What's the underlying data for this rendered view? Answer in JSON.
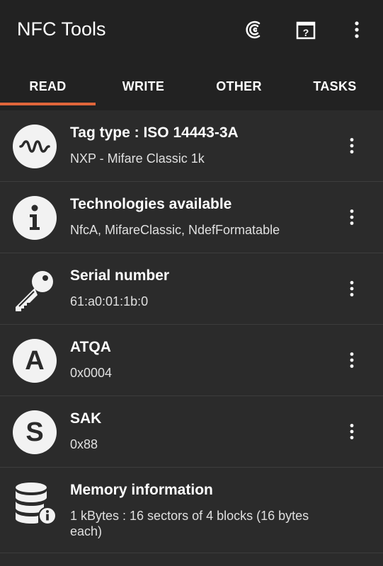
{
  "app": {
    "title": "NFC Tools"
  },
  "toolbar": {
    "icons": [
      "nfc-scan-icon",
      "help-icon",
      "overflow-menu-icon"
    ]
  },
  "tabs": [
    {
      "label": "READ",
      "active": true
    },
    {
      "label": "WRITE",
      "active": false
    },
    {
      "label": "OTHER",
      "active": false
    },
    {
      "label": "TASKS",
      "active": false
    }
  ],
  "rows": [
    {
      "title": "Tag type : ISO 14443-3A",
      "subtitle": "NXP - Mifare Classic 1k",
      "icon": "waveform-icon"
    },
    {
      "title": "Technologies available",
      "subtitle": "NfcA, MifareClassic, NdefFormatable",
      "icon": "info-icon"
    },
    {
      "title": "Serial number",
      "subtitle": "61:a0:01:1b:0",
      "icon": "key-icon"
    },
    {
      "title": "ATQA",
      "subtitle": "0x0004",
      "icon": "atqa-icon",
      "glyph": "A"
    },
    {
      "title": "SAK",
      "subtitle": "0x88",
      "icon": "sak-icon",
      "glyph": "S"
    },
    {
      "title": "Memory information",
      "subtitle": "1 kBytes : 16 sectors of 4 blocks (16 bytes each)",
      "icon": "database-info-icon"
    }
  ],
  "colors": {
    "background": "#2b2b2b",
    "appbar": "#222222",
    "accent": "#e0653a"
  }
}
